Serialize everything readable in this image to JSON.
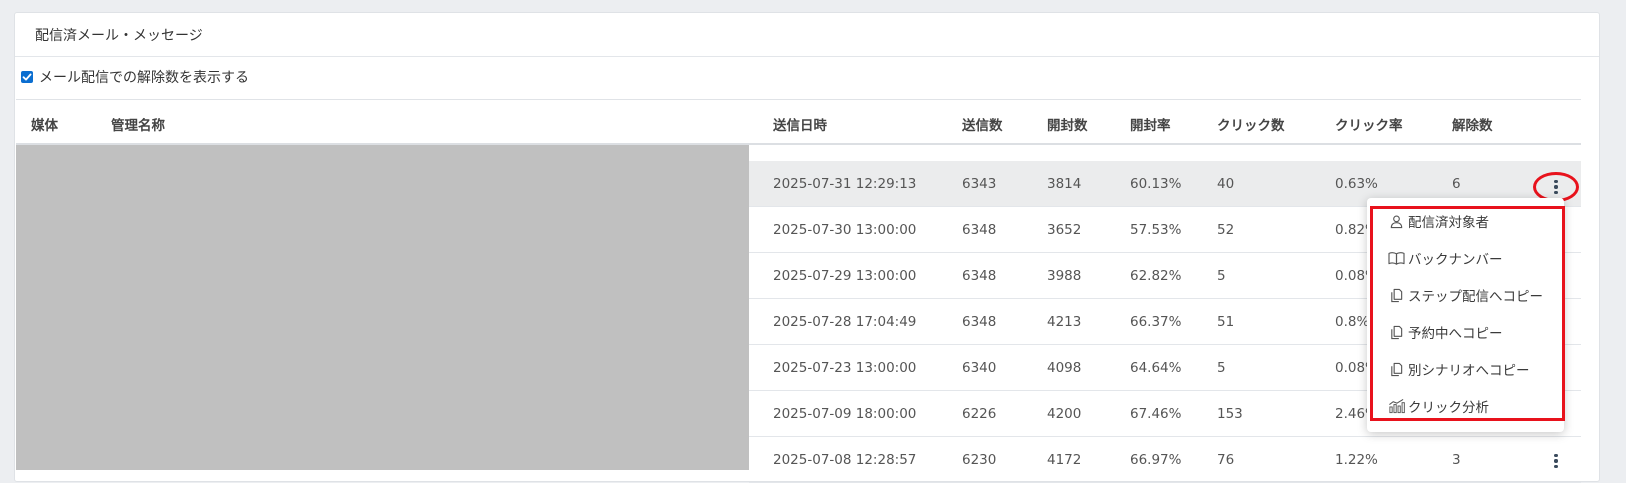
{
  "panel": {
    "title": "配信済メール・メッセージ"
  },
  "options": {
    "show_unsubscribe_label": "メール配信での解除数を表示する",
    "show_unsubscribe_checked": true
  },
  "table": {
    "headers": {
      "media": "媒体",
      "name": "管理名称",
      "sent_at": "送信日時",
      "sent": "送信数",
      "opened": "開封数",
      "open_rate": "開封率",
      "clicks": "クリック数",
      "click_rate": "クリック率",
      "unsubscribes": "解除数"
    },
    "rows": [
      {
        "sent_at": "2025-07-31 12:29:13",
        "sent": "6343",
        "opened": "3814",
        "open_rate": "60.13%",
        "clicks": "40",
        "click_rate": "0.63%",
        "unsubscribes": "6"
      },
      {
        "sent_at": "2025-07-30 13:00:00",
        "sent": "6348",
        "opened": "3652",
        "open_rate": "57.53%",
        "clicks": "52",
        "click_rate": "0.82%",
        "unsubscribes": ""
      },
      {
        "sent_at": "2025-07-29 13:00:00",
        "sent": "6348",
        "opened": "3988",
        "open_rate": "62.82%",
        "clicks": "5",
        "click_rate": "0.08%",
        "unsubscribes": ""
      },
      {
        "sent_at": "2025-07-28 17:04:49",
        "sent": "6348",
        "opened": "4213",
        "open_rate": "66.37%",
        "clicks": "51",
        "click_rate": "0.8%",
        "unsubscribes": ""
      },
      {
        "sent_at": "2025-07-23 13:00:00",
        "sent": "6340",
        "opened": "4098",
        "open_rate": "64.64%",
        "clicks": "5",
        "click_rate": "0.08%",
        "unsubscribes": ""
      },
      {
        "sent_at": "2025-07-09 18:00:00",
        "sent": "6226",
        "opened": "4200",
        "open_rate": "67.46%",
        "clicks": "153",
        "click_rate": "2.46%",
        "unsubscribes": ""
      },
      {
        "sent_at": "2025-07-08 12:28:57",
        "sent": "6230",
        "opened": "4172",
        "open_rate": "66.97%",
        "clicks": "76",
        "click_rate": "1.22%",
        "unsubscribes": "3"
      }
    ]
  },
  "context_menu": {
    "items": [
      {
        "label": "配信済対象者",
        "icon": "user-icon"
      },
      {
        "label": "バックナンバー",
        "icon": "book-icon"
      },
      {
        "label": "ステップ配信へコピー",
        "icon": "copy-icon"
      },
      {
        "label": "予約中へコピー",
        "icon": "copy-icon"
      },
      {
        "label": "別シナリオへコピー",
        "icon": "copy-icon"
      },
      {
        "label": "クリック分析",
        "icon": "chart-icon"
      }
    ]
  },
  "colors": {
    "accent": "#0b6ed0",
    "annotation_red": "#e8121c",
    "redacted_gray": "#c0c0c0"
  }
}
